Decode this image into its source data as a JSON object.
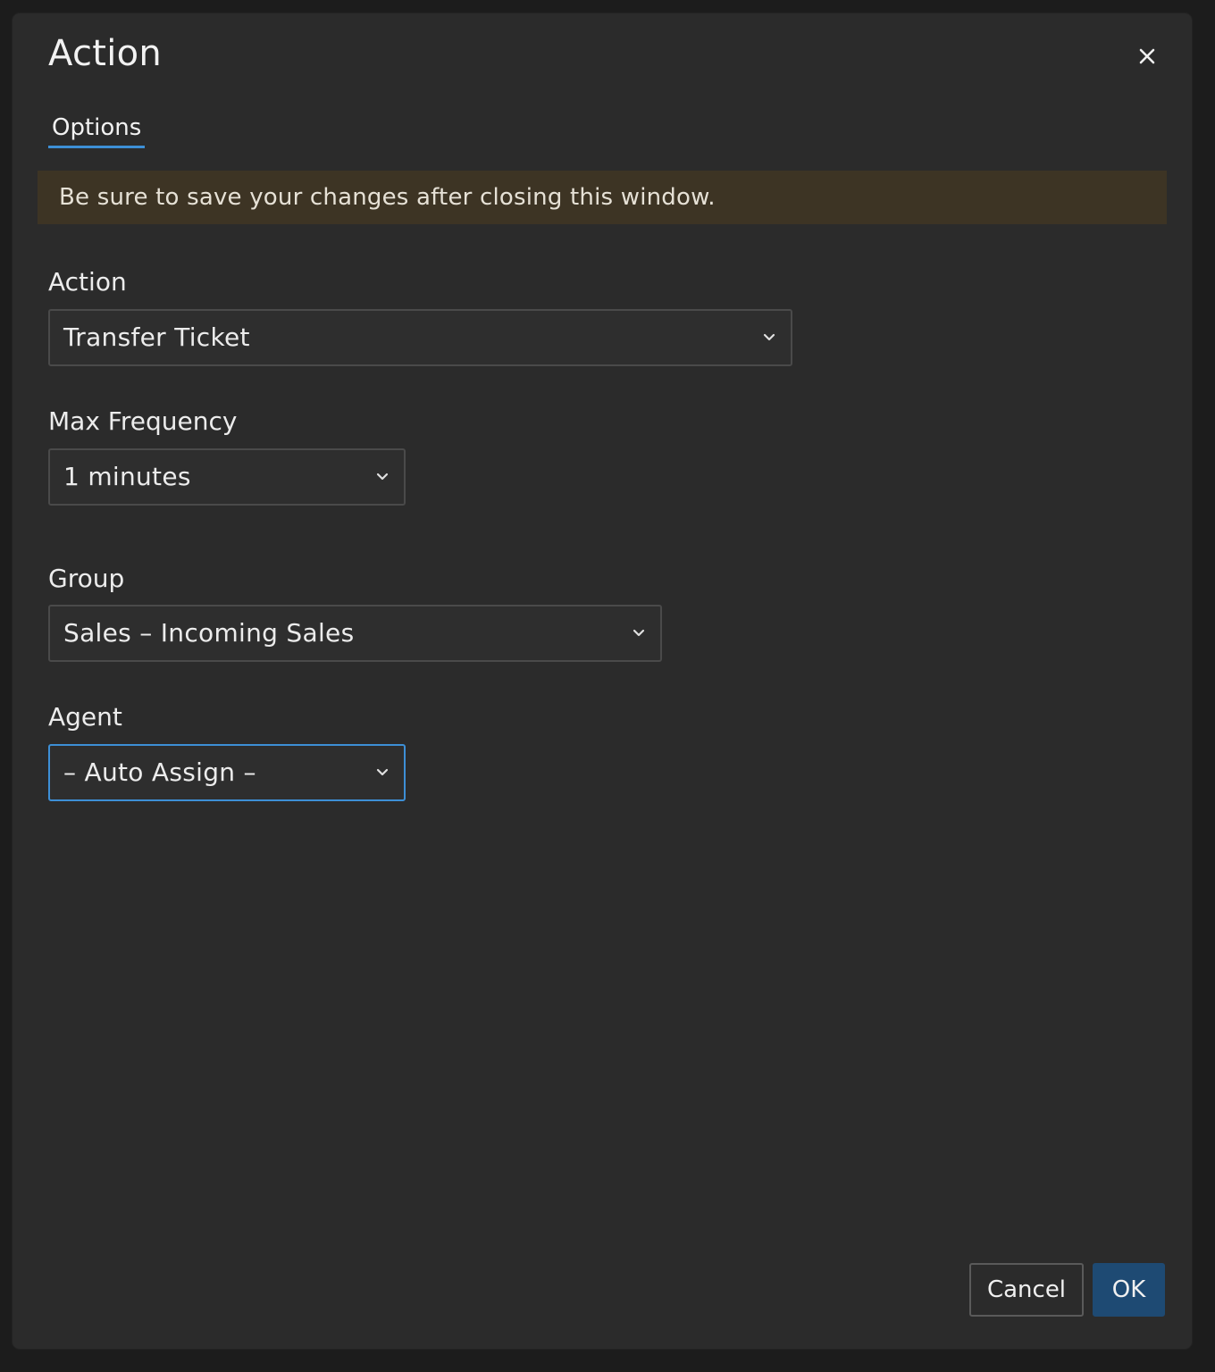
{
  "dialog": {
    "title": "Action",
    "close_icon": "close-icon",
    "tabs": [
      {
        "label": "Options",
        "active": true
      }
    ],
    "notice": "Be sure to save your changes after closing this window.",
    "fields": {
      "action": {
        "label": "Action",
        "value": "Transfer Ticket"
      },
      "max_frequency": {
        "label": "Max Frequency",
        "value": "1 minutes"
      },
      "group": {
        "label": "Group",
        "value": "Sales – Incoming Sales"
      },
      "agent": {
        "label": "Agent",
        "value": "– Auto Assign –"
      }
    },
    "buttons": {
      "cancel": "Cancel",
      "ok": "OK"
    }
  },
  "colors": {
    "dialog_bg": "#2b2b2b",
    "notice_bg": "#3d3424",
    "accent": "#3d8fd6",
    "primary_button": "#1e4a73"
  }
}
